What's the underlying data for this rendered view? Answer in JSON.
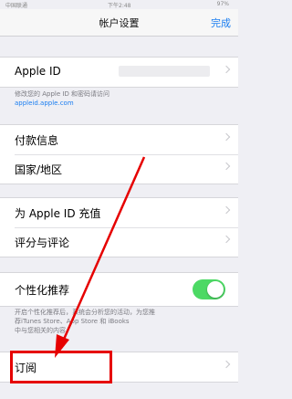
{
  "status_bar": {
    "carrier": "中国联通",
    "time": "下午2:48",
    "battery": "97%"
  },
  "nav": {
    "title": "帐户设置",
    "done_label": "完成"
  },
  "apple_id": {
    "label": "Apple ID",
    "note_line1": "修改您的 Apple ID 和密码请访问",
    "note_link": "appleid.apple.com"
  },
  "group_payment": {
    "items": [
      "付款信息",
      "国家/地区"
    ]
  },
  "group_topup": {
    "items": [
      "为 Apple ID 充值",
      "评分与评论"
    ]
  },
  "personalized": {
    "label": "个性化推荐",
    "enabled": true,
    "note_line1": "开启个性化推荐后，系统会分析您的活动，为您推",
    "note_line2": "荐iTunes Store、App Store 和 iBooks",
    "note_line3": "中与您相关的内容。"
  },
  "subscriptions": {
    "label": "订阅"
  },
  "annotation": {
    "highlight_color": "#e60000"
  }
}
